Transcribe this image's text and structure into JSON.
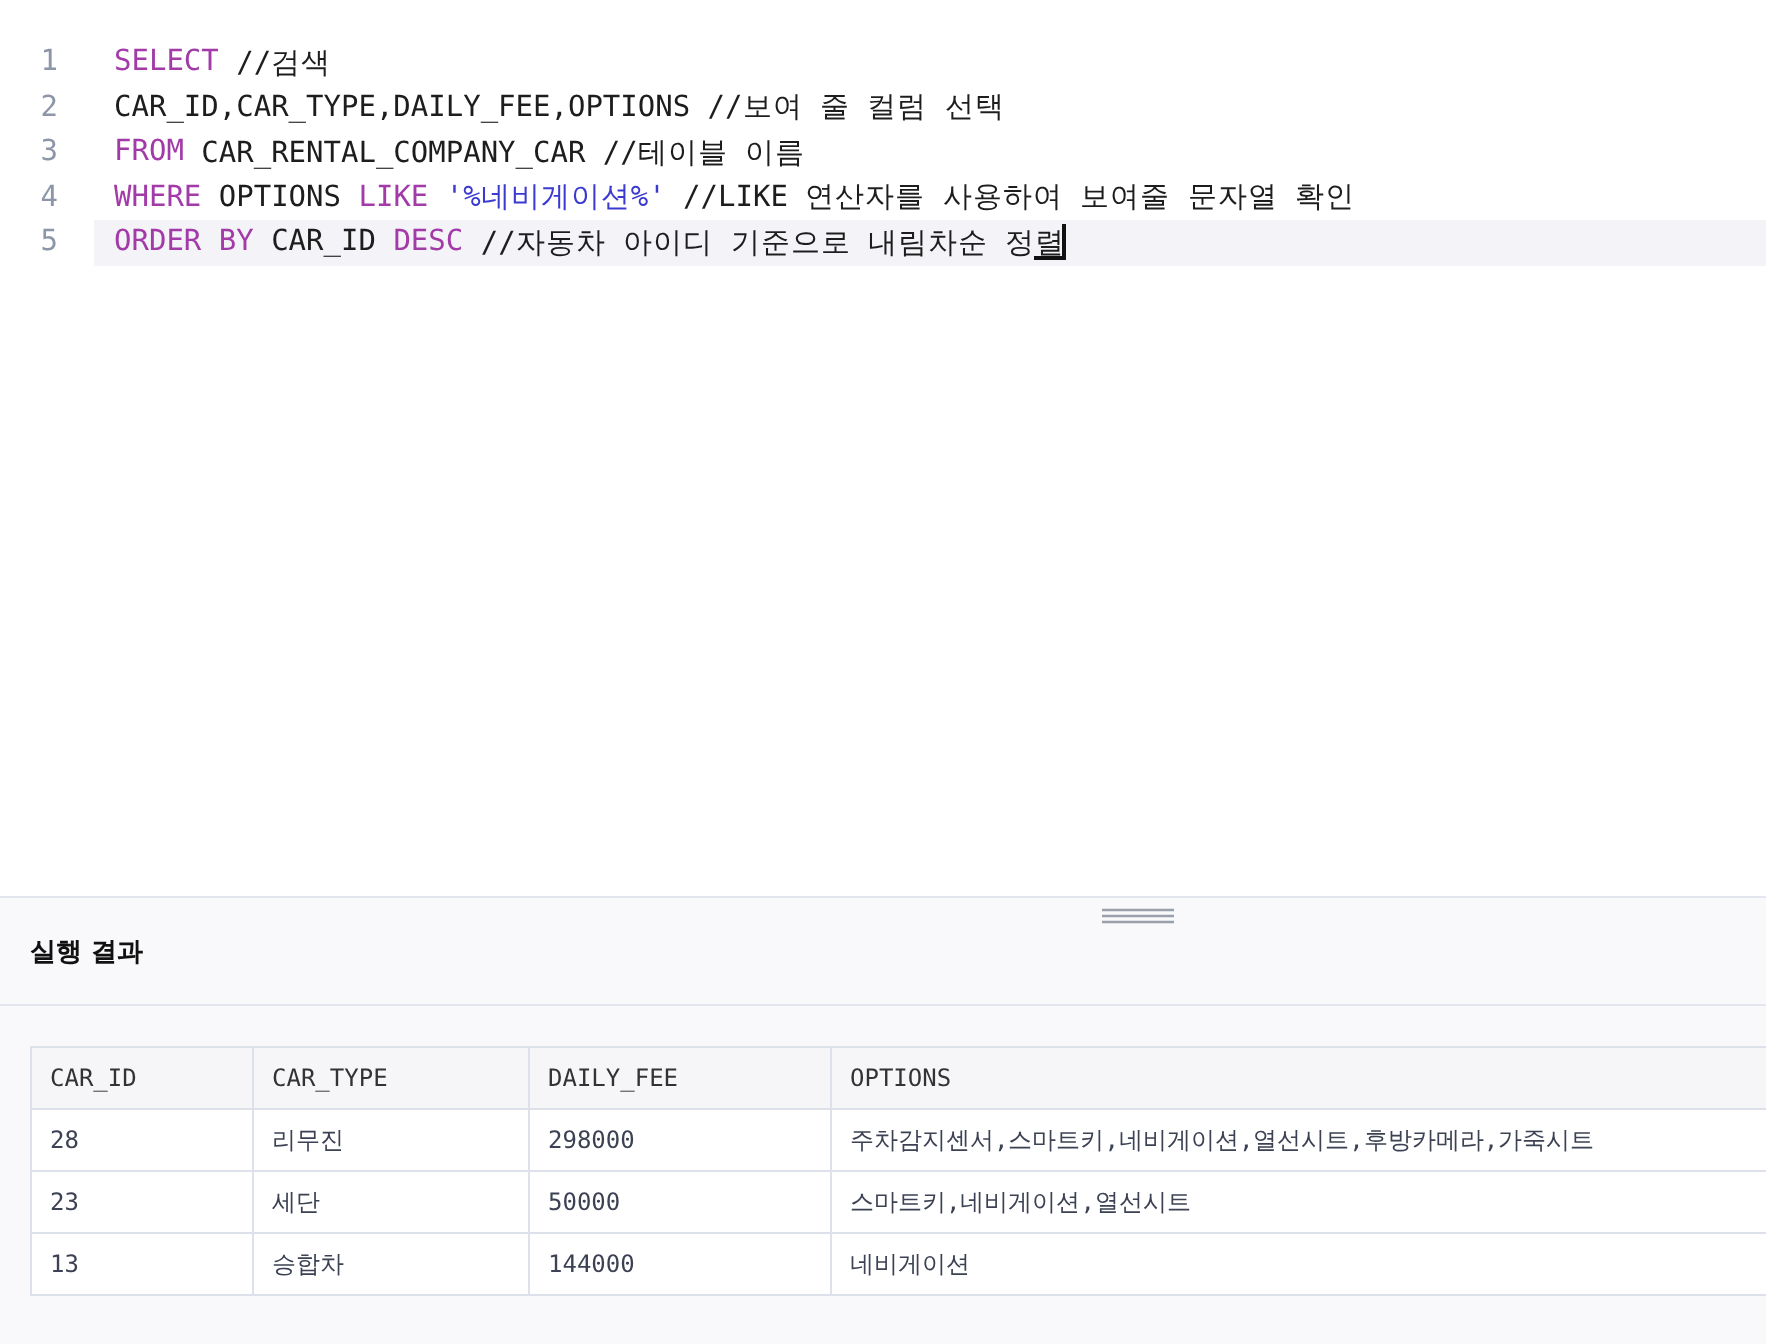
{
  "editor": {
    "lines": [
      {
        "number": "1",
        "current": false,
        "tokens": [
          {
            "kind": "keyword",
            "text": "SELECT"
          },
          {
            "kind": "plain",
            "text": " //검색"
          }
        ]
      },
      {
        "number": "2",
        "current": false,
        "tokens": [
          {
            "kind": "plain",
            "text": "CAR_ID,CAR_TYPE,DAILY_FEE,OPTIONS //보여 줄 컬럼 선택"
          }
        ]
      },
      {
        "number": "3",
        "current": false,
        "tokens": [
          {
            "kind": "keyword",
            "text": "FROM"
          },
          {
            "kind": "plain",
            "text": " CAR_RENTAL_COMPANY_CAR //테이블 이름"
          }
        ]
      },
      {
        "number": "4",
        "current": false,
        "tokens": [
          {
            "kind": "keyword",
            "text": "WHERE"
          },
          {
            "kind": "plain",
            "text": " OPTIONS "
          },
          {
            "kind": "keyword",
            "text": "LIKE"
          },
          {
            "kind": "string",
            "text": " '%네비게이션%'"
          },
          {
            "kind": "plain",
            "text": " //LIKE 연산자를 사용하여 보여줄 문자열 확인"
          }
        ]
      },
      {
        "number": "5",
        "current": true,
        "tokens": [
          {
            "kind": "keyword",
            "text": "ORDER BY"
          },
          {
            "kind": "plain",
            "text": " CAR_ID "
          },
          {
            "kind": "keyword",
            "text": "DESC"
          },
          {
            "kind": "plain",
            "text": " //자동차 아이디 기준으로 내림차순 정렬"
          }
        ]
      }
    ]
  },
  "results": {
    "title": "실행 결과",
    "table": {
      "columns": [
        "CAR_ID",
        "CAR_TYPE",
        "DAILY_FEE",
        "OPTIONS"
      ],
      "rows": [
        [
          "28",
          "리무진",
          "298000",
          "주차감지센서,스마트키,네비게이션,열선시트,후방카메라,가죽시트"
        ],
        [
          "23",
          "세단",
          "50000",
          "스마트키,네비게이션,열선시트"
        ],
        [
          "13",
          "승합차",
          "144000",
          "네비게이션"
        ]
      ]
    }
  }
}
